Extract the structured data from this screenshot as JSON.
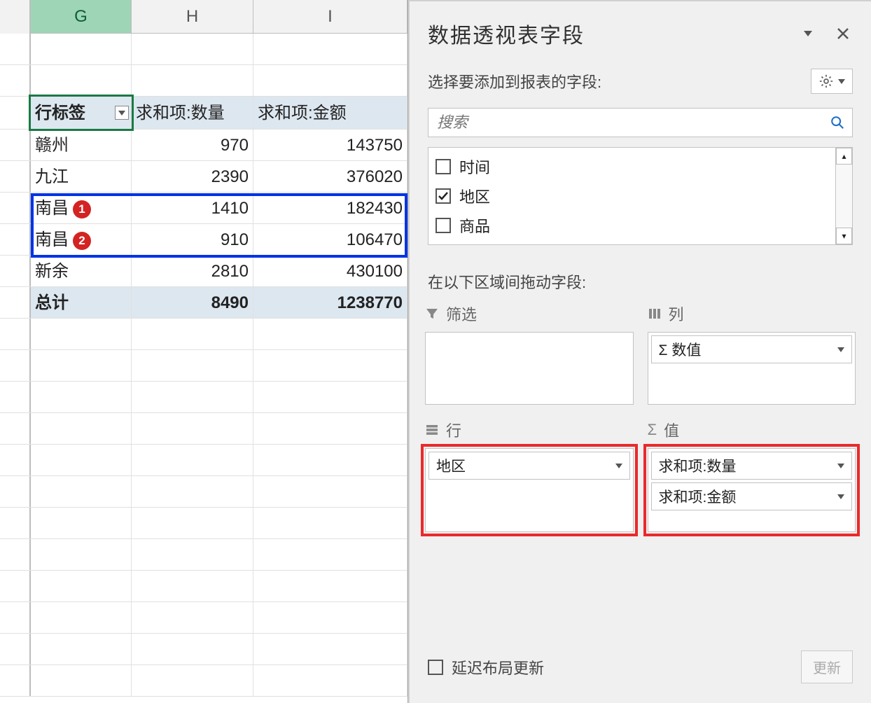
{
  "columns": {
    "g": "G",
    "h": "H",
    "i": "I"
  },
  "pivot": {
    "headers": {
      "rowlabels": "行标签",
      "qty": "求和项:数量",
      "amount": "求和项:金额"
    },
    "rows": [
      {
        "label": "赣州",
        "qty": "970",
        "amount": "143750",
        "badge": null
      },
      {
        "label": "九江",
        "qty": "2390",
        "amount": "376020",
        "badge": null
      },
      {
        "label": "南昌",
        "qty": "1410",
        "amount": "182430",
        "badge": "1"
      },
      {
        "label": "南昌",
        "qty": "910",
        "amount": "106470",
        "badge": "2"
      },
      {
        "label": "新余",
        "qty": "2810",
        "amount": "430100",
        "badge": null
      }
    ],
    "total": {
      "label": "总计",
      "qty": "8490",
      "amount": "1238770"
    }
  },
  "pane": {
    "title": "数据透视表字段",
    "subtitle": "选择要添加到报表的字段:",
    "search_placeholder": "搜索",
    "fields": [
      {
        "label": "时间",
        "checked": false
      },
      {
        "label": "地区",
        "checked": true
      },
      {
        "label": "商品",
        "checked": false
      }
    ],
    "areas_label": "在以下区域间拖动字段:",
    "areas": {
      "filter": {
        "title": "筛选",
        "chips": []
      },
      "columns": {
        "title": "列",
        "chips": [
          "Σ 数值"
        ]
      },
      "rows": {
        "title": "行",
        "chips": [
          "地区"
        ]
      },
      "values": {
        "title": "值",
        "chips": [
          "求和项:数量",
          "求和项:金额"
        ]
      }
    },
    "defer_label": "延迟布局更新",
    "update_label": "更新"
  }
}
